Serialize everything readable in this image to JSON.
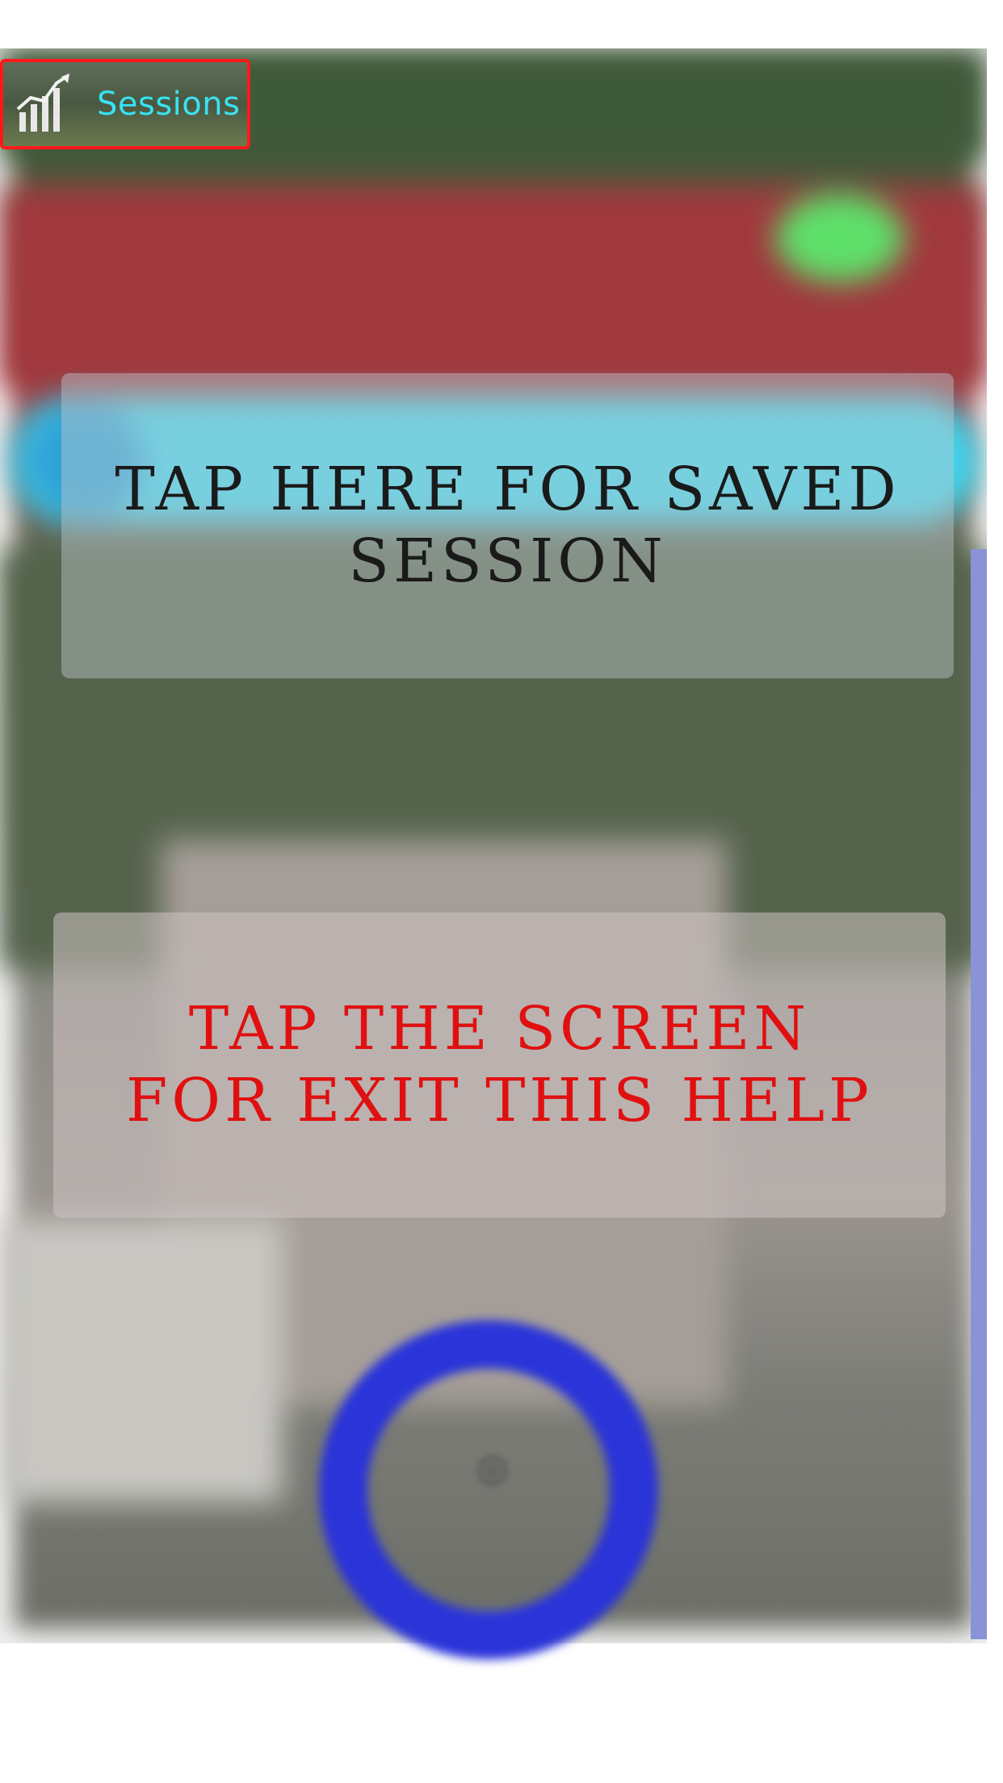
{
  "sessions_button": {
    "label": "Sessions",
    "icon": "bar-chart-growth-icon",
    "label_color": "#38e3f2",
    "highlight_color": "#ff1a1a"
  },
  "help_overlay": {
    "saved_session_hint": "TAP HERE FOR SAVED\nSESSION",
    "exit_hint": "TAP THE SCREEN\nFOR EXIT THIS HELP",
    "exit_hint_color": "#e01010"
  },
  "background": {
    "ring_color": "#2a34d9",
    "ring_icon": "record-ring-icon",
    "accent_cyan": "#3fd7ef",
    "status_dot": "#5ee06a"
  }
}
